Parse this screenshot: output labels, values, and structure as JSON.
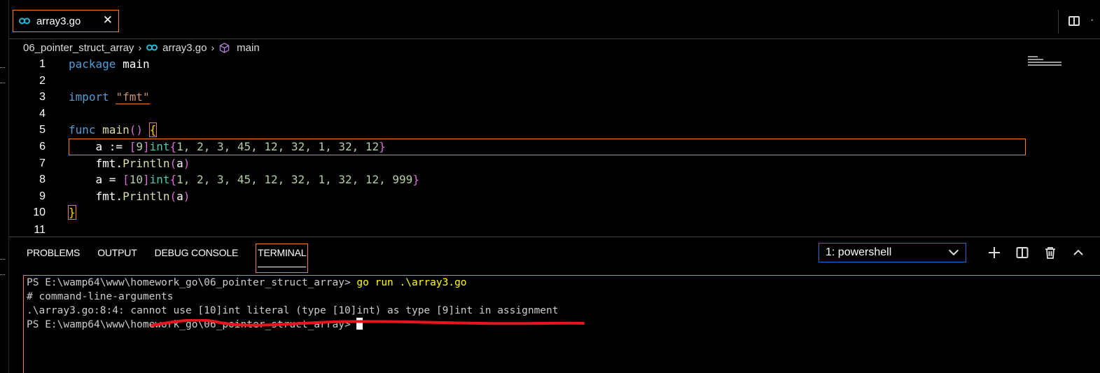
{
  "tab": {
    "label": "array3.go",
    "close": "✕",
    "icon": "go-file-icon"
  },
  "breadcrumb": {
    "folder": "06_pointer_struct_array",
    "file": "array3.go",
    "symbol": "main"
  },
  "editor": {
    "lines": [
      {
        "n": "1"
      },
      {
        "n": "2"
      },
      {
        "n": "3"
      },
      {
        "n": "4"
      },
      {
        "n": "5"
      },
      {
        "n": "6"
      },
      {
        "n": "7"
      },
      {
        "n": "8"
      },
      {
        "n": "9"
      },
      {
        "n": "10"
      },
      {
        "n": "11"
      }
    ],
    "code": {
      "l1_kw": "package",
      "l1_rest": " main",
      "l3_kw": "import",
      "l3_str": "\"fmt\"",
      "l5_kw": "func",
      "l5_fn": "main",
      "l6_a": "a := ",
      "l6_len": "9",
      "l6_ty": "int",
      "l6_vals": "1, 2, 3, 45, 12, 32, 1, 32, 12",
      "l7_pkg": "fmt.",
      "l7_fn": "Println",
      "l7_arg": "a",
      "l8_a": "a = ",
      "l8_len": "10",
      "l8_ty": "int",
      "l8_vals": "1, 2, 3, 45, 12, 32, 1, 32, 12, 999",
      "l9_pkg": "fmt.",
      "l9_fn": "Println",
      "l9_arg": "a"
    }
  },
  "panel": {
    "tabs": [
      "PROBLEMS",
      "OUTPUT",
      "DEBUG CONSOLE",
      "TERMINAL"
    ],
    "active_tab": "TERMINAL",
    "shell_select": "1: powershell"
  },
  "terminal": {
    "prompt1": "PS E:\\wamp64\\www\\homework_go\\06_pointer_struct_array> ",
    "cmd1": "go run .\\array3.go",
    "line2": "# command-line-arguments",
    "line3": ".\\array3.go:8:4: cannot use [10]int literal (type [10]int) as type [9]int in assignment",
    "prompt2": "PS E:\\wamp64\\www\\homework_go\\06_pointer_struct_array> "
  }
}
